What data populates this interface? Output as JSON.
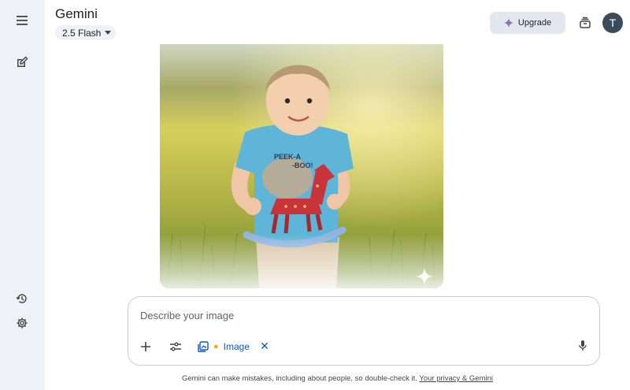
{
  "app": {
    "title": "Gemini",
    "model": "2.5 Flash"
  },
  "header": {
    "upgrade_label": "Upgrade",
    "avatar_initial": "T"
  },
  "composer": {
    "placeholder": "Describe your image",
    "chip_label": "Image"
  },
  "footer": {
    "disclaimer": "Gemini can make mistakes, including about people, so double-check it.",
    "privacy_link": "Your privacy & Gemini"
  },
  "colors": {
    "sidebar_bg": "#eef2f7",
    "accent": "#0b57d0",
    "avatar_bg": "#3c4b5b",
    "upgrade_bg": "#e3e8ef"
  }
}
